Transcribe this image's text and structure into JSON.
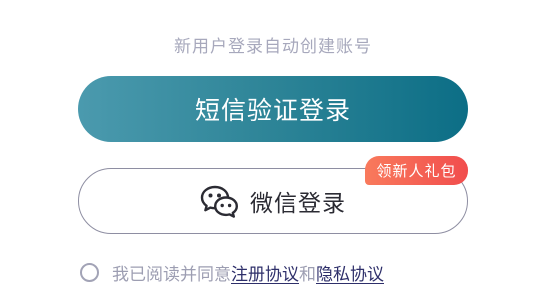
{
  "hint": "新用户登录自动创建账号",
  "sms_button": {
    "label": "短信验证登录"
  },
  "wechat_button": {
    "label": "微信登录",
    "icon": "wechat-icon"
  },
  "badge": {
    "label": "领新人礼包"
  },
  "agreement": {
    "prefix": "我已阅读并同意",
    "register_link": "注册协议",
    "and": "和",
    "privacy_link": "隐私协议",
    "checked": false
  },
  "colors": {
    "primary_start": "#4b9aae",
    "primary_end": "#0c6e86",
    "badge": "#f14d4d",
    "link": "#2e2f6a"
  }
}
